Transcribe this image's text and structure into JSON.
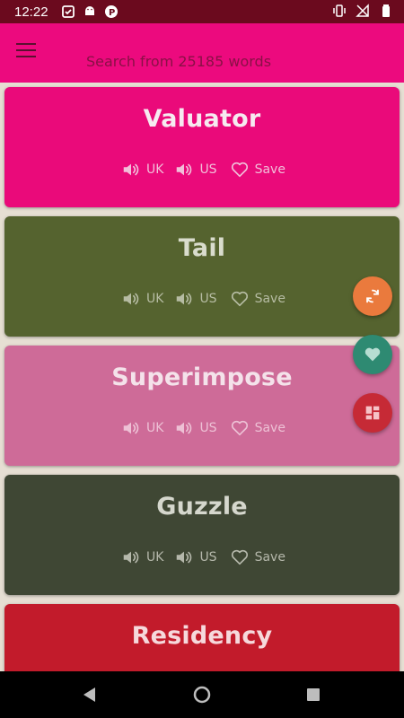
{
  "status_bar": {
    "time": "12:22",
    "left_icons": [
      "checklist-icon",
      "android-icon",
      "p-icon"
    ],
    "right_icons": [
      "vibrate-icon",
      "no-signal-icon",
      "battery-icon"
    ]
  },
  "app_bar": {
    "search_placeholder": "Search from 25185 words",
    "color": "#ec0a7e"
  },
  "action_labels": {
    "uk": "UK",
    "us": "US",
    "save": "Save"
  },
  "words": [
    {
      "word": "Valuator",
      "bg": "#ea0a7a",
      "text": "#f6eaf0",
      "sub": "#f1bfd9"
    },
    {
      "word": "Tail",
      "bg": "#55632f",
      "text": "#d9dccd",
      "sub": "#b6bca3"
    },
    {
      "word": "Superimpose",
      "bg": "#ce6b98",
      "text": "#f4e2ea",
      "sub": "#edc1d5"
    },
    {
      "word": "Guzzle",
      "bg": "#3f4734",
      "text": "#d5d7cd",
      "sub": "#b5b8ab"
    },
    {
      "word": "Residency",
      "bg": "#c21b2b",
      "text": "#f6d9dc",
      "sub": "#eab1b6"
    }
  ],
  "fabs": [
    {
      "name": "shuffle-icon",
      "color": "#ea7a3d"
    },
    {
      "name": "favorites-heart-icon",
      "color": "#2e8a72"
    },
    {
      "name": "dashboard-icon",
      "color": "#c62a36"
    }
  ]
}
